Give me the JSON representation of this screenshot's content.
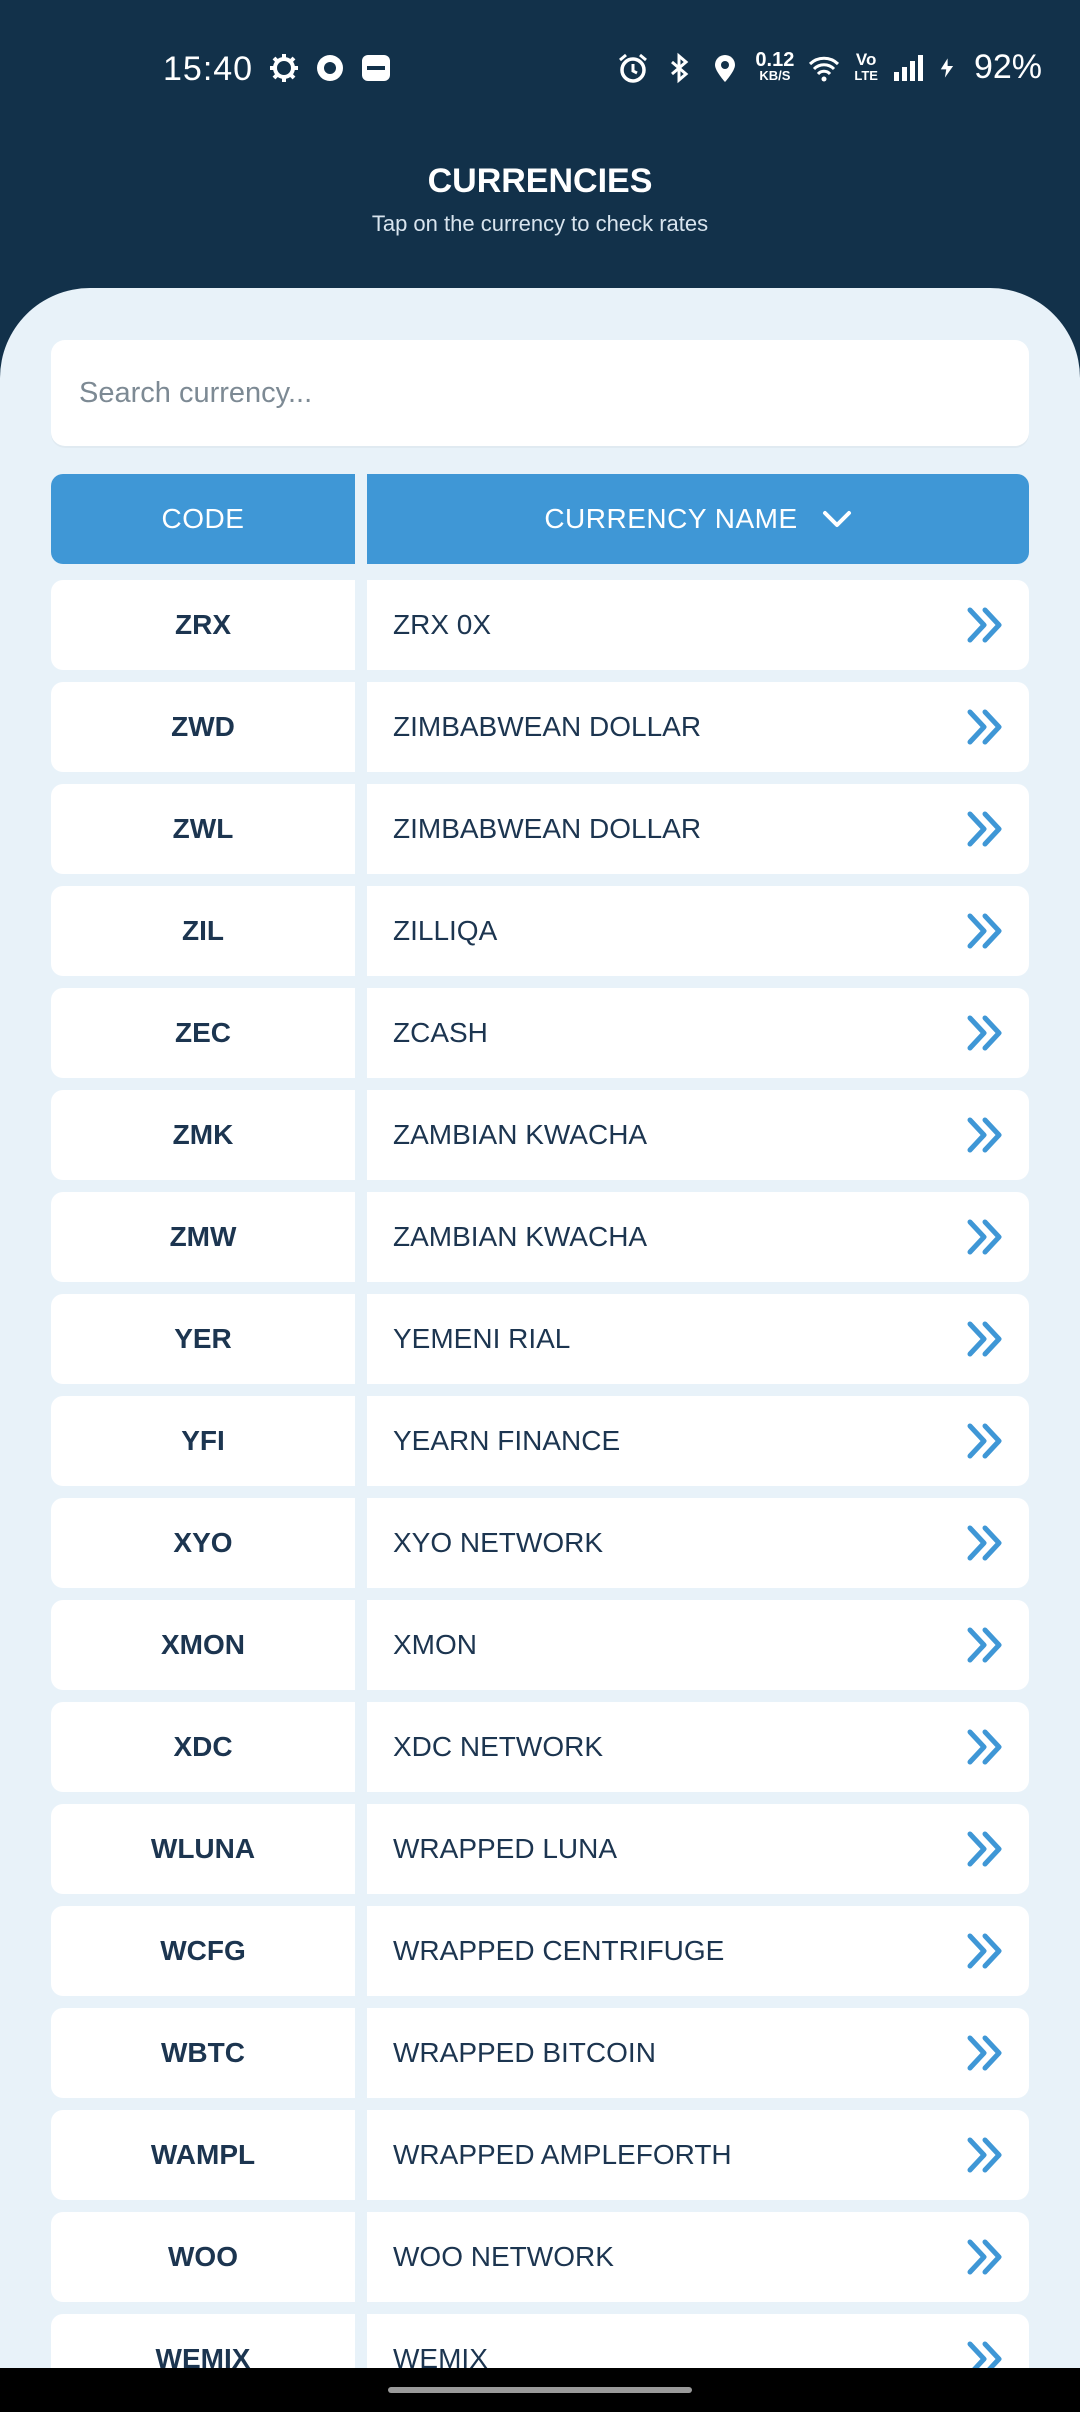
{
  "status_bar": {
    "time": "15:40",
    "net_speed_value": "0.12",
    "net_speed_unit": "KB/S",
    "volte_top": "Vo",
    "volte_bottom": "LTE",
    "battery": "92%",
    "left_icons": [
      "settings-icon",
      "circle-icon",
      "paytm-icon"
    ],
    "right_icons": [
      "alarm-icon",
      "bluetooth-icon",
      "location-icon",
      "wifi-icon",
      "signal-icon",
      "charging-icon"
    ]
  },
  "header": {
    "title": "CURRENCIES",
    "subtitle": "Tap on the currency to check rates"
  },
  "search": {
    "placeholder": "Search currency...",
    "value": ""
  },
  "table": {
    "code_header": "CODE",
    "name_header": "CURRENCY NAME",
    "rows": [
      {
        "code": "ZRX",
        "name": "ZRX 0X"
      },
      {
        "code": "ZWD",
        "name": "ZIMBABWEAN DOLLAR"
      },
      {
        "code": "ZWL",
        "name": "ZIMBABWEAN DOLLAR"
      },
      {
        "code": "ZIL",
        "name": "ZILLIQA"
      },
      {
        "code": "ZEC",
        "name": "ZCASH"
      },
      {
        "code": "ZMK",
        "name": "ZAMBIAN KWACHA"
      },
      {
        "code": "ZMW",
        "name": "ZAMBIAN KWACHA"
      },
      {
        "code": "YER",
        "name": "YEMENI RIAL"
      },
      {
        "code": "YFI",
        "name": "YEARN FINANCE"
      },
      {
        "code": "XYO",
        "name": "XYO NETWORK"
      },
      {
        "code": "XMON",
        "name": "XMON"
      },
      {
        "code": "XDC",
        "name": "XDC NETWORK"
      },
      {
        "code": "WLUNA",
        "name": "WRAPPED LUNA"
      },
      {
        "code": "WCFG",
        "name": "WRAPPED CENTRIFUGE"
      },
      {
        "code": "WBTC",
        "name": "WRAPPED BITCOIN"
      },
      {
        "code": "WAMPL",
        "name": "WRAPPED AMPLEFORTH"
      },
      {
        "code": "WOO",
        "name": "WOO NETWORK"
      },
      {
        "code": "WEMIX",
        "name": "WEMIX"
      }
    ]
  },
  "colors": {
    "header_bg": "#12314a",
    "panel_bg": "#e8f2f9",
    "accent": "#3f97d6",
    "text_dark": "#1c3550"
  }
}
